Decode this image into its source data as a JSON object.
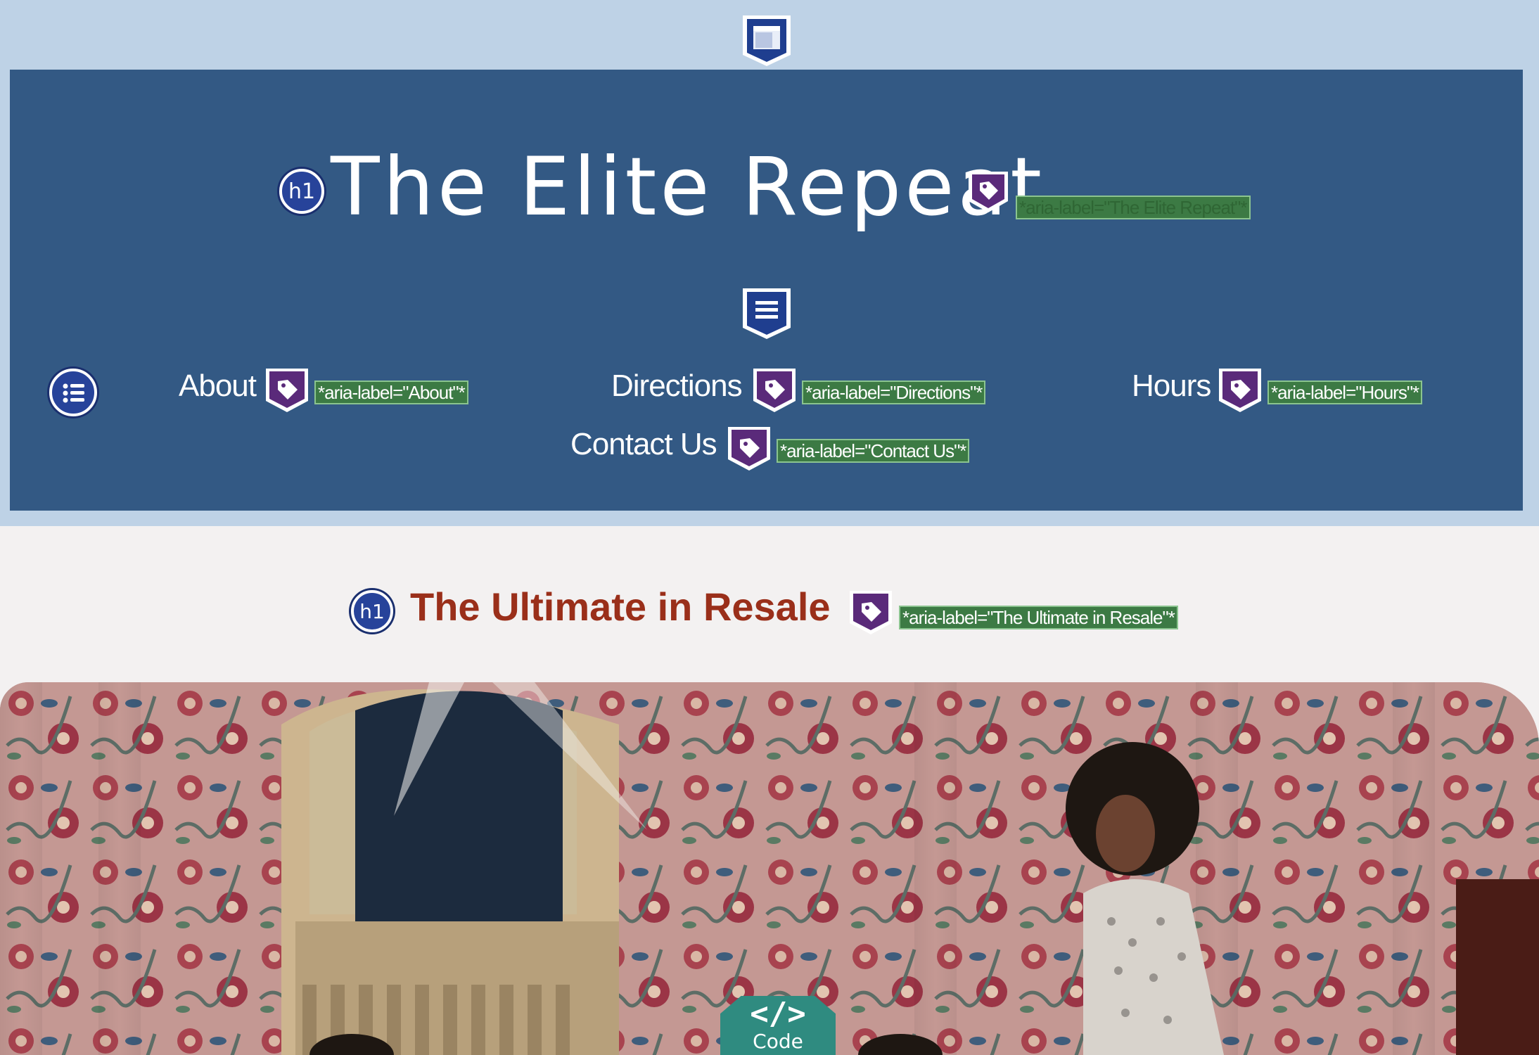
{
  "header": {
    "title": "The Elite Repeat",
    "title_badge": "h1",
    "title_aria": "*aria-label=\"The Elite Repeat\"*"
  },
  "nav": {
    "items": [
      {
        "label": "About",
        "aria": "*aria-label=\"About\"*"
      },
      {
        "label": "Directions",
        "aria": "*aria-label=\"Directions\"*"
      },
      {
        "label": "Hours",
        "aria": "*aria-label=\"Hours\"*"
      },
      {
        "label": "Contact Us",
        "aria": "*aria-label=\"Contact Us\"*"
      }
    ]
  },
  "main": {
    "heading": "The Ultimate in Resale",
    "heading_badge": "h1",
    "heading_aria": "*aria-label=\"The Ultimate in Resale\"*"
  },
  "code_button": {
    "glyph": "</>",
    "label": "Code"
  },
  "icons": {
    "header_landmark": "header-landmark-icon",
    "nav_landmark": "navigation-landmark-icon",
    "list": "list-icon",
    "tag": "tag-icon"
  },
  "colors": {
    "page_background": "#f3f1f1",
    "top_band": "#bed2e6",
    "header_background": "#335984",
    "heading_text": "#9a2f1a",
    "tag_purple": "#5a2a7a",
    "aria_label_green": "#3c7a44",
    "badge_blue": "#27439a",
    "code_button": "#2f8b80"
  }
}
